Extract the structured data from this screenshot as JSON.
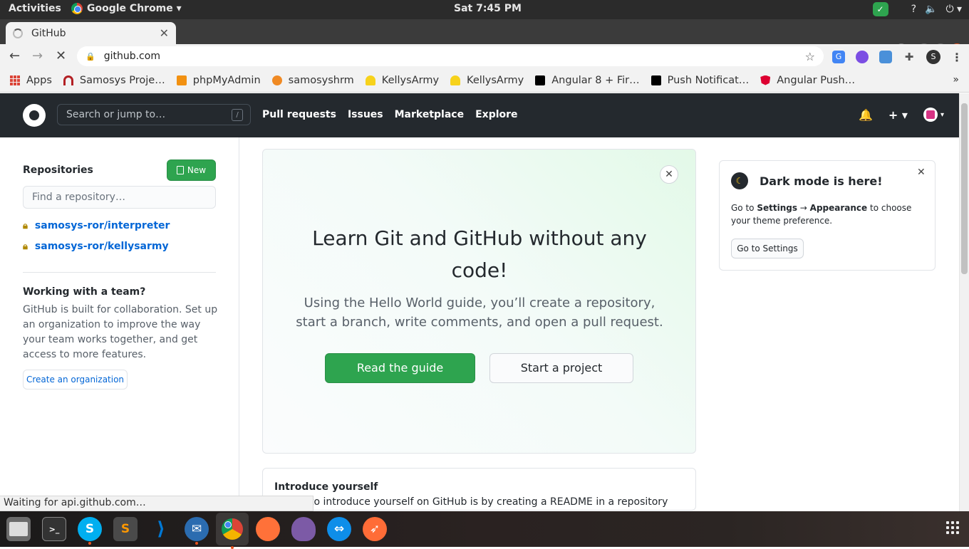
{
  "ubuntu_bar": {
    "activities": "Activities",
    "app_name": "Google Chrome ▾",
    "clock": "Sat  7:45 PM"
  },
  "browser": {
    "tab_title": "GitHub",
    "url": "github.com",
    "profile_initial": "S"
  },
  "bookmarks": [
    {
      "label": "Apps",
      "icon": "apps-grid-icon"
    },
    {
      "label": "Samosys Proje…",
      "icon": "redmine-icon",
      "color": "#b32024"
    },
    {
      "label": "phpMyAdmin",
      "icon": "phpmyadmin-icon",
      "color": "#f29111"
    },
    {
      "label": "samosyshrm",
      "icon": "orange-fruit-icon",
      "color": "#f08a24"
    },
    {
      "label": "KellysArmy",
      "icon": "helmet-icon",
      "color": "#f7d21b"
    },
    {
      "label": "KellysArmy",
      "icon": "helmet-icon",
      "color": "#f7d21b"
    },
    {
      "label": "Angular 8 + Fir…",
      "icon": "medium-icon",
      "color": "#000000"
    },
    {
      "label": "Push Notificat…",
      "icon": "medium-icon",
      "color": "#000000"
    },
    {
      "label": "Angular Push…",
      "icon": "angular-icon",
      "color": "#dd0031"
    }
  ],
  "github": {
    "search_placeholder": "Search or jump to…",
    "search_shortcut": "/",
    "nav": [
      "Pull requests",
      "Issues",
      "Marketplace",
      "Explore"
    ],
    "sidebar": {
      "repositories_title": "Repositories",
      "new_button": "New",
      "find_placeholder": "Find a repository…",
      "repos": [
        "samosys-ror/interpreter",
        "samosys-ror/kellysarmy"
      ],
      "team_title": "Working with a team?",
      "team_text": "GitHub is built for collaboration. Set up an organization to improve the way your team works together, and get access to more features.",
      "create_org_button": "Create an organization"
    },
    "learn_card": {
      "title": "Learn Git and GitHub without any code!",
      "text": "Using the Hello World guide, you’ll create a repository, start a branch, write comments, and open a pull request.",
      "read_guide": "Read the guide",
      "start_project": "Start a project"
    },
    "intro_card": {
      "title": "Introduce yourself",
      "text": "st way to introduce yourself on GitHub is by creating a README in a repository"
    },
    "dark_mode_card": {
      "title": "Dark mode is here!",
      "text_prefix": "Go to ",
      "text_settings": "Settings",
      "text_arrow": " → ",
      "text_appearance": "Appearance",
      "text_suffix": " to choose your theme preference.",
      "button": "Go to Settings"
    }
  },
  "status": "Waiting for api.github.com…",
  "dock": [
    {
      "name": "files-icon"
    },
    {
      "name": "terminal-icon"
    },
    {
      "name": "skype-icon",
      "label": "S",
      "color": "#00aff0",
      "running": true
    },
    {
      "name": "sublime-text-icon",
      "color": "#ff9800"
    },
    {
      "name": "vscode-icon",
      "color": "#0078d4"
    },
    {
      "name": "thunderbird-icon",
      "color": "#2b6cb0",
      "running": true
    },
    {
      "name": "chrome-icon",
      "running": true,
      "active": true
    },
    {
      "name": "firefox-icon",
      "color": "#ff7139"
    },
    {
      "name": "pidgin-icon",
      "color": "#7c5aa6"
    },
    {
      "name": "teamviewer-icon",
      "color": "#0e8ee9"
    },
    {
      "name": "postman-icon",
      "color": "#ff6c37"
    }
  ]
}
